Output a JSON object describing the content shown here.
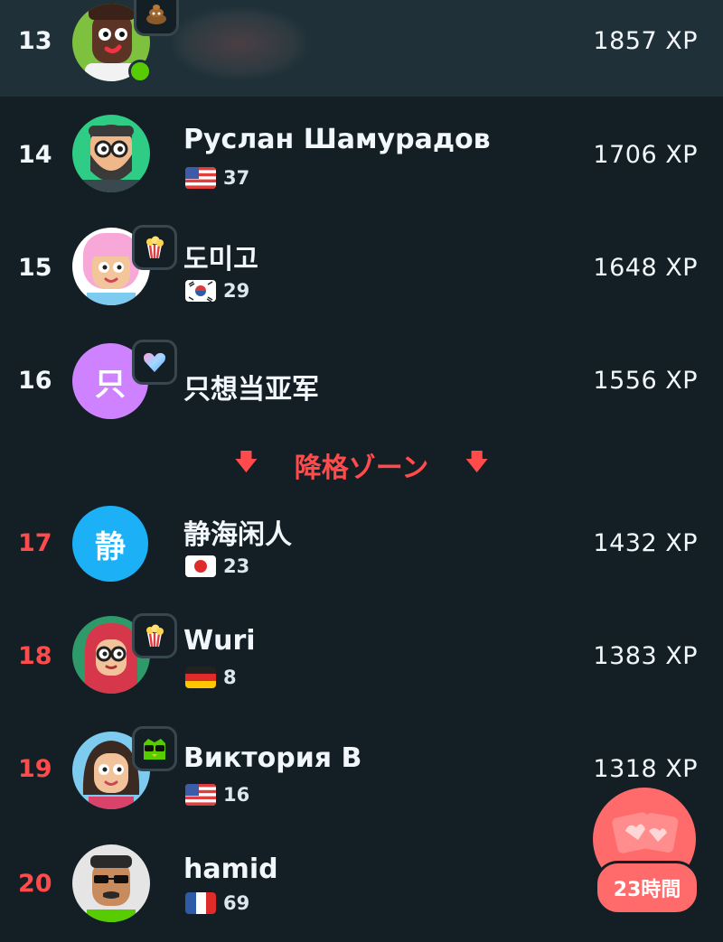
{
  "leaderboard": {
    "rows": [
      {
        "rank": "13",
        "name": "",
        "xp": "1857 XP"
      },
      {
        "rank": "14",
        "name": "Руслан Шамурадов",
        "streak": "37",
        "xp": "1706 XP"
      },
      {
        "rank": "15",
        "name": "도미고",
        "streak": "29",
        "xp": "1648 XP"
      },
      {
        "rank": "16",
        "name": "只想当亚军",
        "avatar_letter": "只",
        "xp": "1556 XP"
      },
      {
        "rank": "17",
        "name": "静海闲人",
        "avatar_letter": "静",
        "streak": "23",
        "xp": "1432 XP"
      },
      {
        "rank": "18",
        "name": "Wuri",
        "streak": "8",
        "xp": "1383 XP"
      },
      {
        "rank": "19",
        "name": "Виктория В",
        "streak": "16",
        "xp": "1318 XP"
      },
      {
        "rank": "20",
        "name": "hamid",
        "streak": "69",
        "xp": ""
      }
    ],
    "demotion_zone_label": "降格ゾーン"
  },
  "reward_chest": {
    "timer": "23時間"
  },
  "colors": {
    "background": "#131f24",
    "highlight": "#1f3038",
    "demote": "#ff4b4b",
    "reward": "#ff6b6b"
  },
  "icons": {
    "row13_badge": "poop-icon",
    "row15_badge": "popcorn-icon",
    "row16_badge": "heart-icon",
    "row18_badge": "popcorn-icon",
    "row19_badge": "owl-sunglasses-icon",
    "flags": [
      "us-flag-icon",
      "korea-flag-icon",
      "japan-flag-icon",
      "germany-flag-icon",
      "us-flag-icon",
      "france-flag-icon"
    ]
  }
}
